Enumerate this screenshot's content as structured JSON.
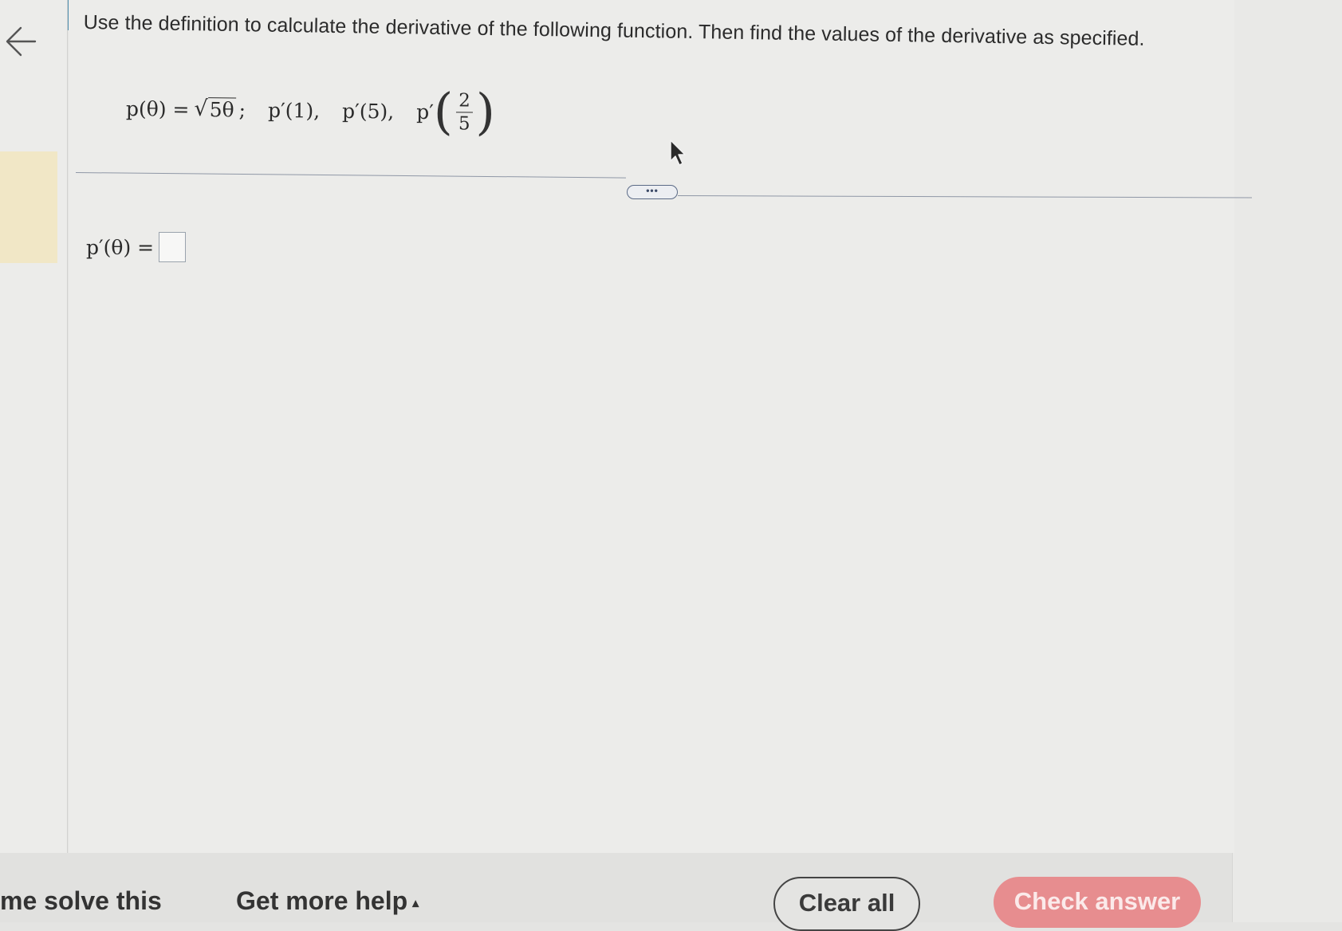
{
  "question": {
    "instruction": "Use the definition to calculate the derivative of the following function. Then find the values of the derivative as specified.",
    "function_lhs": "p(θ) =",
    "sqrt_radicand": "5θ",
    "semicolon": ";",
    "value_1": "p′(1),",
    "value_2": "p′(5),",
    "value_3_prefix": "p′",
    "value_3_paren_open": "(",
    "value_3_paren_close": ")",
    "value_3_numerator": "2",
    "value_3_denominator": "5"
  },
  "divider": {
    "expand_label": "•••"
  },
  "answer": {
    "label": "p′(θ) =",
    "value": ""
  },
  "footer": {
    "solve_label": "me solve this",
    "help_label": "Get more help",
    "help_caret": "▴",
    "clear_label": "Clear all",
    "check_label": "Check answer"
  },
  "colors": {
    "header_blue": "#4f8fb0",
    "check_button": "#e78d8f",
    "highlight": "#f1e7c6"
  }
}
